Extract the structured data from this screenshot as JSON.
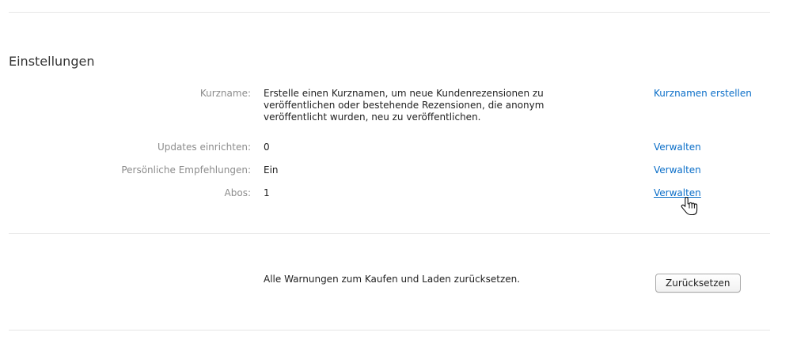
{
  "section": {
    "title": "Einstellungen"
  },
  "settings": [
    {
      "label": "Kurzname:",
      "value": "Erstelle einen Kurznamen, um neue Kundenrezensionen zu veröffentlichen oder bestehende Rezensionen, die anonym veröffentlicht wurden, neu zu veröffentlichen.",
      "action": "Kurznamen erstellen"
    },
    {
      "label": "Updates einrichten:",
      "value": "0",
      "action": "Verwalten"
    },
    {
      "label": "Persönliche Empfehlungen:",
      "value": "Ein",
      "action": "Verwalten"
    },
    {
      "label": "Abos:",
      "value": "1",
      "action": "Verwalten"
    }
  ],
  "warnings": {
    "text": "Alle Warnungen zum Kaufen und Laden zurücksetzen.",
    "button_label": "Zurücksetzen"
  },
  "colors": {
    "link": "#0a6ec8",
    "label": "#8c8c8c",
    "divider": "#e6e6e6"
  },
  "icons": {
    "cursor": "hand-pointer-icon"
  }
}
